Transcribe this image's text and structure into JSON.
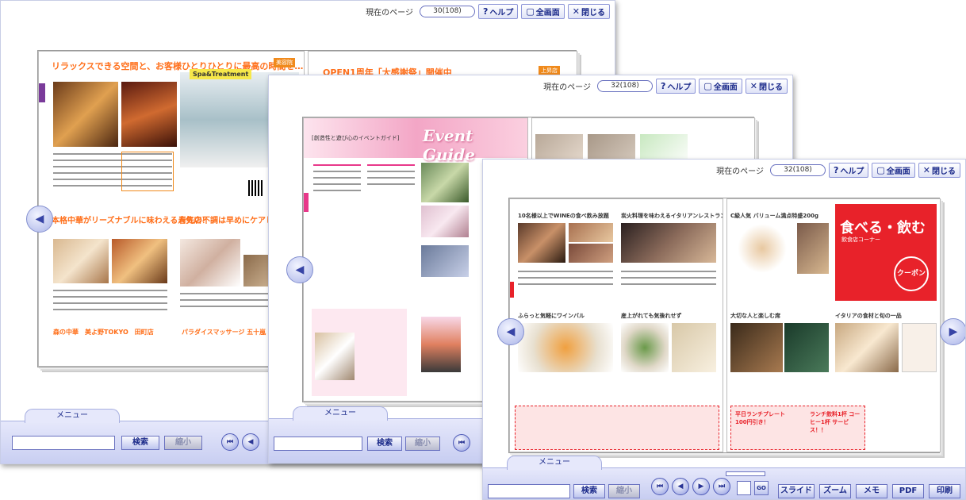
{
  "toolbar": {
    "page_label": "現在のページ",
    "page_value_1": "30(108)",
    "page_value_2": "32(108)",
    "page_value_3": "32(108)",
    "help_label": "ヘルプ",
    "fullscreen_label": "全画面",
    "close_label": "閉じる"
  },
  "bottom": {
    "menu_tab": "メニュー",
    "search_button": "検索",
    "shrink_button": "縮小",
    "slide_label": "スライド",
    "zoom_label": "ズーム",
    "memo_label": "メモ",
    "pdf_label": "PDF",
    "print_label": "印刷",
    "go_label": "GO"
  },
  "window1": {
    "headline_left": "リラックスできる空間と、お客様ひとりひとりに最高の時間を…",
    "headline_right": "OPEN1周年「大感謝祭」開催中",
    "tag_left": "美容院",
    "tag_right": "上昇店",
    "sub_headline_1": "本格中華がリーズナブルに味わえる人気店！",
    "sub_headline_2": "春先の不調は早めにケアしてスッキリ！",
    "shop_label": "Spa&Treatment",
    "bottom_caption_1": "森の中華　美よ野TOKYO　田町店",
    "bottom_caption_2": "パラダイスマッサージ 五十嵐"
  },
  "window2": {
    "event_guide": "Event Guide",
    "guide_subtitle": "[創造性と遊び心のイベントガイド]"
  },
  "window3": {
    "food_title": "食べる・飲む",
    "food_sub": "飲食店コーナー",
    "coupon": "クーポン",
    "lunch_title": "平日ランチプレート 100円引き！",
    "coffee_title": "ランチ飲料1杯 コーヒー1杯 サービス！！",
    "restaurant_1": "10名様以上でWINEの食べ飲み放題",
    "restaurant_2": "炭火料理を味わえるイタリアンレストラン",
    "restaurant_3": "C級人気 バリューム満点特盛200g",
    "restaurant_4": "ふらっと気軽にワインバル",
    "restaurant_5": "産上がれても気後れせず",
    "restaurant_6": "大切な人と楽しむ席",
    "restaurant_7": "イタリアの食材と旬の一品"
  },
  "colors": {
    "accent_blue": "#2a3595",
    "orange": "#f08a1c",
    "pink": "#f3a6c6",
    "red": "#e8222a"
  }
}
